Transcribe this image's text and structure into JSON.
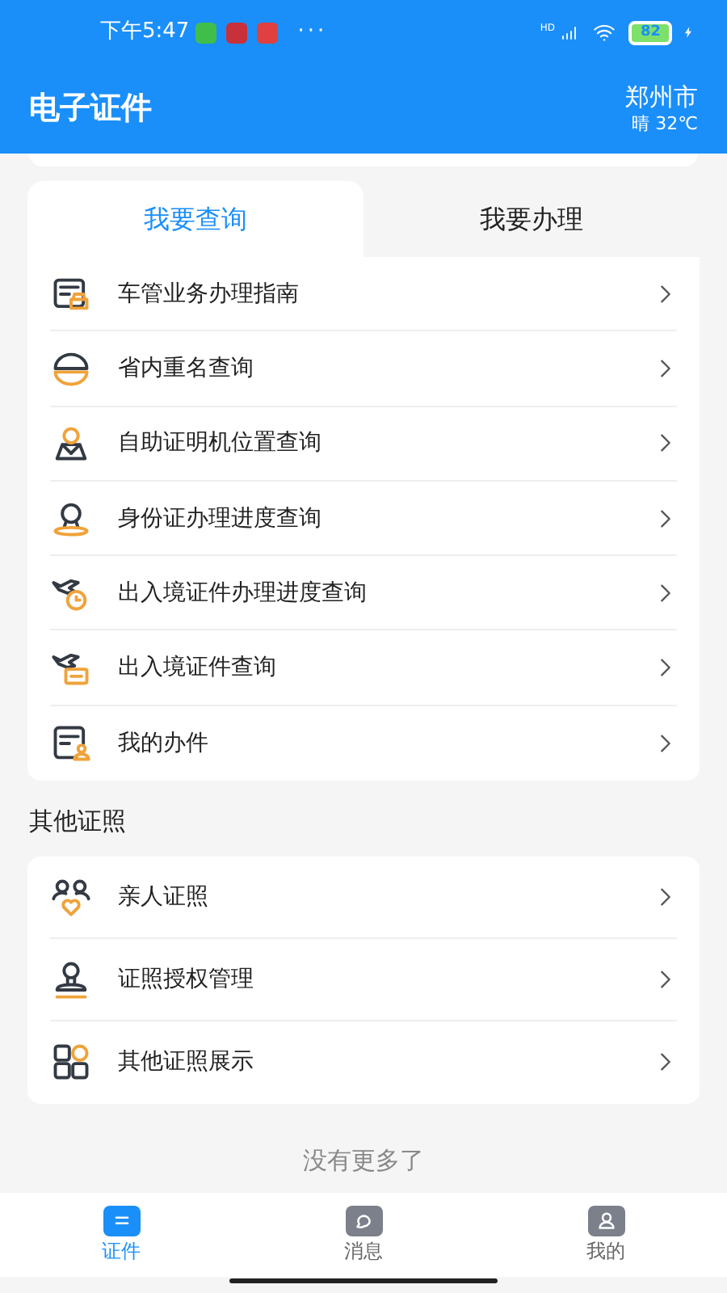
{
  "status_bar": {
    "time": "下午5:47",
    "more": "···",
    "network": "HD",
    "battery": "82"
  },
  "header": {
    "title": "电子证件",
    "city": "郑州市",
    "weather": "晴 32℃"
  },
  "tabs": [
    {
      "label": "我要查询",
      "selected": true
    },
    {
      "label": "我要办理",
      "selected": false
    }
  ],
  "query_items": [
    {
      "label": "车管业务办理指南"
    },
    {
      "label": "省内重名查询"
    },
    {
      "label": "自助证明机位置查询"
    },
    {
      "label": "身份证办理进度查询"
    },
    {
      "label": "出入境证件办理进度查询"
    },
    {
      "label": "出入境证件查询"
    },
    {
      "label": "我的办件"
    }
  ],
  "other_section": {
    "title": "其他证照",
    "items": [
      {
        "label": "亲人证照"
      },
      {
        "label": "证照授权管理"
      },
      {
        "label": "其他证照展示"
      }
    ]
  },
  "footer_note": "没有更多了",
  "bottom_nav": [
    {
      "label": "证件",
      "selected": true
    },
    {
      "label": "消息",
      "selected": false
    },
    {
      "label": "我的",
      "selected": false
    }
  ]
}
